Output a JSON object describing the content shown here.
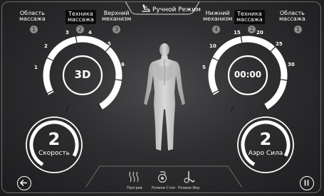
{
  "top_tabs": {
    "left_area": "Область\nмассажа",
    "left_technique": "Техника\nмассажа",
    "upper_mechanism": "Верхний\nмеханизм",
    "mode": "Ручной Режим",
    "lower_mechanism": "Нижний\nмеханизм",
    "right_technique": "Техника\nмассажа",
    "right_area": "Область\nмассажа"
  },
  "tab_numbers": {
    "left_area": "1",
    "left_technique": "2",
    "upper_mechanism": "3",
    "lower_mechanism": "4",
    "right_technique": "2",
    "right_area": "1"
  },
  "left_dial": {
    "value": "3D",
    "ticks": [
      "1",
      "2",
      "3",
      "4",
      "5",
      "6"
    ]
  },
  "right_dial": {
    "value": "00:00",
    "ticks": [
      "5",
      "10",
      "15",
      "20",
      "25",
      "30"
    ]
  },
  "speed": {
    "value": "2",
    "label": "Скорость"
  },
  "air_force": {
    "value": "2",
    "label": "Аэро Сила"
  },
  "bottom_bar": {
    "heating_label": "Прогрев",
    "foot_rollers_label": "Ролики Стоп",
    "calf_rollers_label": "Ролики Икр"
  },
  "colors": {
    "accent": "#ffffff",
    "background": "#2e2e30",
    "tab_badge": "#8c8c8c"
  },
  "icons": {
    "back": "arrow-left-icon",
    "pause": "pause-icon",
    "heating": "heat-waves-icon",
    "foot_rollers": "foot-roller-icon",
    "calf_rollers": "calf-roller-icon",
    "mode": "massage-chair-icon"
  }
}
